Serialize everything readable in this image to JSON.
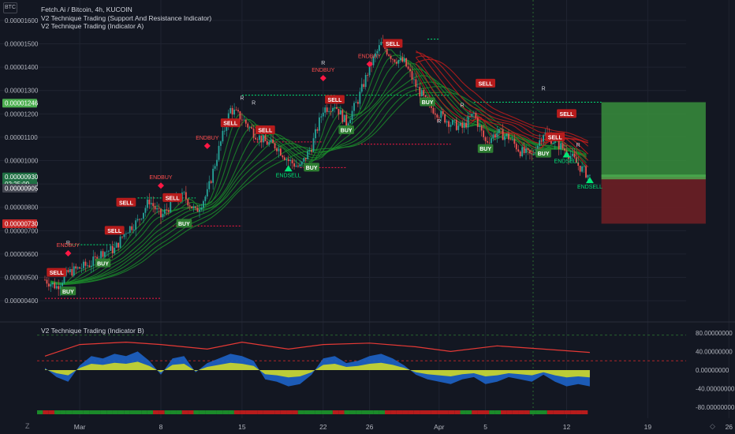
{
  "symbol_badge": "BTC",
  "legend": {
    "line1": "Fetch.Ai / Bitcoin, 4h, KUCOIN",
    "line2": "V2 Technique Trading (Support And Resistance Indicator)",
    "line3": "V2 Technique Trading (Indicator A)"
  },
  "indicator_b_label": "V2 Technique Trading (Indicator B)",
  "corner_left": "Z",
  "corner_right": "◇",
  "colors": {
    "background": "#131722",
    "grid": "#1f2330",
    "up": "#26a69a",
    "down": "#ef5350",
    "ribbon_green": "#1b8a2a",
    "ribbon_red": "#b71c1c",
    "signal_green": "#2e7d32",
    "signal_red": "#b71c1c",
    "long_target": "#388e3c",
    "long_stop": "#6d1f25",
    "axis_text": "#b2b5be",
    "level_green": "#00e676",
    "level_red": "#ff1744"
  },
  "chart_data": [
    {
      "type": "candlestick",
      "panel": "main",
      "y_axis_ticks": [
        "0.00000400",
        "0.00000500",
        "0.00000600",
        "0.00000700",
        "0.00000800",
        "0.00000900",
        "0.00001000",
        "0.00001100",
        "0.00001200",
        "0.00001300",
        "0.00001400",
        "0.00001500",
        "0.00001600"
      ],
      "ylim": [
        3.7e-06,
        1.62e-05
      ],
      "x_axis_ticks": [
        "Mar",
        "8",
        "15",
        "22",
        "26",
        "Apr",
        "5",
        "12",
        "19",
        "26"
      ],
      "price_tags": [
        {
          "label": "0.00001246",
          "value": 1.246e-05,
          "color": "#4caf50"
        },
        {
          "label": "0.00000930",
          "value": 9.3e-06,
          "color": "#1f6f43"
        },
        {
          "label": "02:25:09",
          "value": 9e-06,
          "color": "#1f6f43"
        },
        {
          "label": "0.00000905",
          "value": 8.82e-06,
          "color": "#434651"
        },
        {
          "label": "0.00000730",
          "value": 7.3e-06,
          "color": "#c62828"
        }
      ],
      "path": [
        {
          "d": "Feb 26",
          "p": 4.9e-06
        },
        {
          "d": "Feb 27",
          "p": 4.6e-06
        },
        {
          "d": "Feb 28",
          "p": 5.2e-06
        },
        {
          "d": "Mar 1",
          "p": 5.4e-06
        },
        {
          "d": "Mar 2",
          "p": 5.6e-06
        },
        {
          "d": "Mar 3",
          "p": 6.1e-06
        },
        {
          "d": "Mar 4",
          "p": 6.2e-06
        },
        {
          "d": "Mar 5",
          "p": 7e-06
        },
        {
          "d": "Mar 6",
          "p": 7.4e-06
        },
        {
          "d": "Mar 7",
          "p": 8.3e-06
        },
        {
          "d": "Mar 8",
          "p": 7.6e-06
        },
        {
          "d": "Mar 9",
          "p": 8.2e-06
        },
        {
          "d": "Mar 10",
          "p": 8.5e-06
        },
        {
          "d": "Mar 11",
          "p": 7.8e-06
        },
        {
          "d": "Mar 12",
          "p": 8.6e-06
        },
        {
          "d": "Mar 13",
          "p": 1.05e-05
        },
        {
          "d": "Mar 14",
          "p": 1.22e-05
        },
        {
          "d": "Mar 15",
          "p": 1.18e-05
        },
        {
          "d": "Mar 16",
          "p": 1.12e-05
        },
        {
          "d": "Mar 17",
          "p": 1.08e-05
        },
        {
          "d": "Mar 18",
          "p": 1.06e-05
        },
        {
          "d": "Mar 19",
          "p": 1e-05
        },
        {
          "d": "Mar 20",
          "p": 9.7e-06
        },
        {
          "d": "Mar 21",
          "p": 1.06e-05
        },
        {
          "d": "Mar 22",
          "p": 1.22e-05
        },
        {
          "d": "Mar 23",
          "p": 1.24e-05
        },
        {
          "d": "Mar 24",
          "p": 1.16e-05
        },
        {
          "d": "Mar 25",
          "p": 1.26e-05
        },
        {
          "d": "Mar 26",
          "p": 1.4e-05
        },
        {
          "d": "Mar 27",
          "p": 1.5e-05
        },
        {
          "d": "Mar 28",
          "p": 1.44e-05
        },
        {
          "d": "Mar 29",
          "p": 1.42e-05
        },
        {
          "d": "Mar 30",
          "p": 1.32e-05
        },
        {
          "d": "Mar 31",
          "p": 1.24e-05
        },
        {
          "d": "Apr 1",
          "p": 1.2e-05
        },
        {
          "d": "Apr 2",
          "p": 1.16e-05
        },
        {
          "d": "Apr 3",
          "p": 1.14e-05
        },
        {
          "d": "Apr 4",
          "p": 1.2e-05
        },
        {
          "d": "Apr 5",
          "p": 1.08e-05
        },
        {
          "d": "Apr 6",
          "p": 1.12e-05
        },
        {
          "d": "Apr 7",
          "p": 1.1e-05
        },
        {
          "d": "Apr 8",
          "p": 1.04e-05
        },
        {
          "d": "Apr 9",
          "p": 1.02e-05
        },
        {
          "d": "Apr 10",
          "p": 1.12e-05
        },
        {
          "d": "Apr 11",
          "p": 1.08e-05
        },
        {
          "d": "Apr 12",
          "p": 1.04e-05
        },
        {
          "d": "Apr 13",
          "p": 9.8e-06
        },
        {
          "d": "Apr 14",
          "p": 9.3e-06
        }
      ],
      "signals": [
        {
          "text": "SELL",
          "d": "Feb 27",
          "p": 5.2e-06,
          "kind": "sell"
        },
        {
          "text": "BUY",
          "d": "Feb 28",
          "p": 4.4e-06,
          "kind": "buy"
        },
        {
          "text": "ENDBUY",
          "d": "Feb 28",
          "p": 6.3e-06,
          "kind": "endbuy"
        },
        {
          "text": "BUY",
          "d": "Mar 3",
          "p": 5.6e-06,
          "kind": "buy"
        },
        {
          "text": "SELL",
          "d": "Mar 4",
          "p": 7e-06,
          "kind": "sell"
        },
        {
          "text": "SELL",
          "d": "Mar 5",
          "p": 8.2e-06,
          "kind": "sell"
        },
        {
          "text": "ENDBUY",
          "d": "Mar 8",
          "p": 9.2e-06,
          "kind": "endbuy"
        },
        {
          "text": "SELL",
          "d": "Mar 9",
          "p": 8.4e-06,
          "kind": "sell"
        },
        {
          "text": "BUY",
          "d": "Mar 10",
          "p": 7.3e-06,
          "kind": "buy"
        },
        {
          "text": "ENDBUY",
          "d": "Mar 12",
          "p": 1.09e-05,
          "kind": "endbuy"
        },
        {
          "text": "SELL",
          "d": "Mar 14",
          "p": 1.16e-05,
          "kind": "sell"
        },
        {
          "text": "SELL",
          "d": "Mar 17",
          "p": 1.13e-05,
          "kind": "sell"
        },
        {
          "text": "ENDSELL",
          "d": "Mar 19",
          "p": 9.4e-06,
          "kind": "endsell"
        },
        {
          "text": "BUY",
          "d": "Mar 21",
          "p": 9.7e-06,
          "kind": "buy"
        },
        {
          "text": "ENDBUY",
          "d": "Mar 22",
          "p": 1.38e-05,
          "kind": "endbuy"
        },
        {
          "text": "SELL",
          "d": "Mar 23",
          "p": 1.26e-05,
          "kind": "sell"
        },
        {
          "text": "BUY",
          "d": "Mar 24",
          "p": 1.13e-05,
          "kind": "buy"
        },
        {
          "text": "ENDBUY",
          "d": "Mar 26",
          "p": 1.44e-05,
          "kind": "endbuy"
        },
        {
          "text": "SELL",
          "d": "Mar 28",
          "p": 1.5e-05,
          "kind": "sell"
        },
        {
          "text": "BUY",
          "d": "Mar 31",
          "p": 1.25e-05,
          "kind": "buy"
        },
        {
          "text": "SELL",
          "d": "Apr 5",
          "p": 1.33e-05,
          "kind": "sell"
        },
        {
          "text": "BUY",
          "d": "Apr 5",
          "p": 1.05e-05,
          "kind": "buy"
        },
        {
          "text": "BUY",
          "d": "Apr 10",
          "p": 1.03e-05,
          "kind": "buy"
        },
        {
          "text": "SELL",
          "d": "Apr 11",
          "p": 1.1e-05,
          "kind": "sell"
        },
        {
          "text": "SELL",
          "d": "Apr 12",
          "p": 1.2e-05,
          "kind": "sell"
        },
        {
          "text": "ENDSELL",
          "d": "Apr 12",
          "p": 1e-05,
          "kind": "endsell"
        },
        {
          "text": "ENDSELL",
          "d": "Apr 14",
          "p": 8.9e-06,
          "kind": "endsell"
        }
      ],
      "r_markers": [
        {
          "d": "Feb 28",
          "p": 6.4e-06
        },
        {
          "d": "Mar 15",
          "p": 1.26e-05
        },
        {
          "d": "Mar 16",
          "p": 1.24e-05
        },
        {
          "d": "Mar 22",
          "p": 1.41e-05
        },
        {
          "d": "Apr 1",
          "p": 1.16e-05
        },
        {
          "d": "Apr 3",
          "p": 1.23e-05
        },
        {
          "d": "Apr 10",
          "p": 1.3e-05
        },
        {
          "d": "Apr 13",
          "p": 1.06e-05
        }
      ],
      "levels": [
        {
          "from": "Feb 26",
          "to": "Mar 8",
          "p": 4.1e-06,
          "kind": "support"
        },
        {
          "from": "Feb 28",
          "to": "Mar 4",
          "p": 6.4e-06,
          "kind": "resistance"
        },
        {
          "from": "Mar 6",
          "to": "Mar 11",
          "p": 8.4e-06,
          "kind": "resistance"
        },
        {
          "from": "Mar 9",
          "to": "Mar 15",
          "p": 7.2e-06,
          "kind": "support"
        },
        {
          "from": "Mar 15",
          "to": "Mar 23",
          "p": 1.28e-05,
          "kind": "resistance"
        },
        {
          "from": "Mar 16",
          "to": "Mar 22",
          "p": 1.08e-05,
          "kind": "support"
        },
        {
          "from": "Mar 20",
          "to": "Mar 24",
          "p": 9.7e-06,
          "kind": "support"
        },
        {
          "from": "Mar 24",
          "to": "Apr 2",
          "p": 1.28e-05,
          "kind": "resistance"
        },
        {
          "from": "Mar 25",
          "to": "Apr 2",
          "p": 1.07e-05,
          "kind": "support"
        },
        {
          "from": "Mar 31",
          "to": "Apr 1",
          "p": 1.52e-05,
          "kind": "resistance"
        },
        {
          "from": "Apr 4",
          "to": "Apr 15",
          "p": 1.25e-05,
          "kind": "resistance"
        }
      ],
      "position": {
        "from": "Apr 15",
        "to": "Apr 24",
        "entry": 9.3e-06,
        "target": 1.25e-05,
        "stop": 7.3e-06
      }
    },
    {
      "type": "area",
      "panel": "indicator_b",
      "y_axis_ticks": [
        "80.00000000",
        "40.00000000",
        "0.00000000",
        "-40.00000000",
        "-80.00000000"
      ],
      "ylim": [
        -100,
        100
      ],
      "reference_lines": [
        75,
        20
      ],
      "oscillator": [
        {
          "d": "Feb 26",
          "v": 5
        },
        {
          "d": "Feb 27",
          "v": -15
        },
        {
          "d": "Feb 28",
          "v": -25
        },
        {
          "d": "Mar 1",
          "v": 10
        },
        {
          "d": "Mar 2",
          "v": 30
        },
        {
          "d": "Mar 3",
          "v": 25
        },
        {
          "d": "Mar 4",
          "v": 35
        },
        {
          "d": "Mar 5",
          "v": 30
        },
        {
          "d": "Mar 6",
          "v": 40
        },
        {
          "d": "Mar 7",
          "v": 20
        },
        {
          "d": "Mar 8",
          "v": -10
        },
        {
          "d": "Mar 9",
          "v": 25
        },
        {
          "d": "Mar 10",
          "v": 30
        },
        {
          "d": "Mar 11",
          "v": -5
        },
        {
          "d": "Mar 12",
          "v": 15
        },
        {
          "d": "Mar 13",
          "v": 25
        },
        {
          "d": "Mar 14",
          "v": 35
        },
        {
          "d": "Mar 15",
          "v": 30
        },
        {
          "d": "Mar 16",
          "v": 20
        },
        {
          "d": "Mar 17",
          "v": -20
        },
        {
          "d": "Mar 18",
          "v": -25
        },
        {
          "d": "Mar 19",
          "v": -35
        },
        {
          "d": "Mar 20",
          "v": -30
        },
        {
          "d": "Mar 21",
          "v": -10
        },
        {
          "d": "Mar 22",
          "v": 25
        },
        {
          "d": "Mar 23",
          "v": 30
        },
        {
          "d": "Mar 24",
          "v": 15
        },
        {
          "d": "Mar 25",
          "v": 20
        },
        {
          "d": "Mar 26",
          "v": 30
        },
        {
          "d": "Mar 27",
          "v": 35
        },
        {
          "d": "Mar 28",
          "v": 25
        },
        {
          "d": "Mar 29",
          "v": 10
        },
        {
          "d": "Mar 30",
          "v": -10
        },
        {
          "d": "Mar 31",
          "v": -20
        },
        {
          "d": "Apr 1",
          "v": -25
        },
        {
          "d": "Apr 2",
          "v": -30
        },
        {
          "d": "Apr 3",
          "v": -20
        },
        {
          "d": "Apr 4",
          "v": -15
        },
        {
          "d": "Apr 5",
          "v": -30
        },
        {
          "d": "Apr 6",
          "v": -25
        },
        {
          "d": "Apr 7",
          "v": -15
        },
        {
          "d": "Apr 8",
          "v": -20
        },
        {
          "d": "Apr 9",
          "v": -25
        },
        {
          "d": "Apr 10",
          "v": -10
        },
        {
          "d": "Apr 11",
          "v": -25
        },
        {
          "d": "Apr 12",
          "v": -35
        },
        {
          "d": "Apr 13",
          "v": -30
        },
        {
          "d": "Apr 14",
          "v": -35
        }
      ],
      "trend_line": [
        {
          "d": "Feb 26",
          "v": 30
        },
        {
          "d": "Mar 1",
          "v": 55
        },
        {
          "d": "Mar 5",
          "v": 60
        },
        {
          "d": "Mar 8",
          "v": 55
        },
        {
          "d": "Mar 12",
          "v": 45
        },
        {
          "d": "Mar 15",
          "v": 60
        },
        {
          "d": "Mar 19",
          "v": 45
        },
        {
          "d": "Mar 22",
          "v": 55
        },
        {
          "d": "Mar 26",
          "v": 58
        },
        {
          "d": "Mar 30",
          "v": 50
        },
        {
          "d": "Apr 2",
          "v": 40
        },
        {
          "d": "Apr 6",
          "v": 52
        },
        {
          "d": "Apr 10",
          "v": 45
        },
        {
          "d": "Apr 14",
          "v": 38
        }
      ]
    }
  ]
}
